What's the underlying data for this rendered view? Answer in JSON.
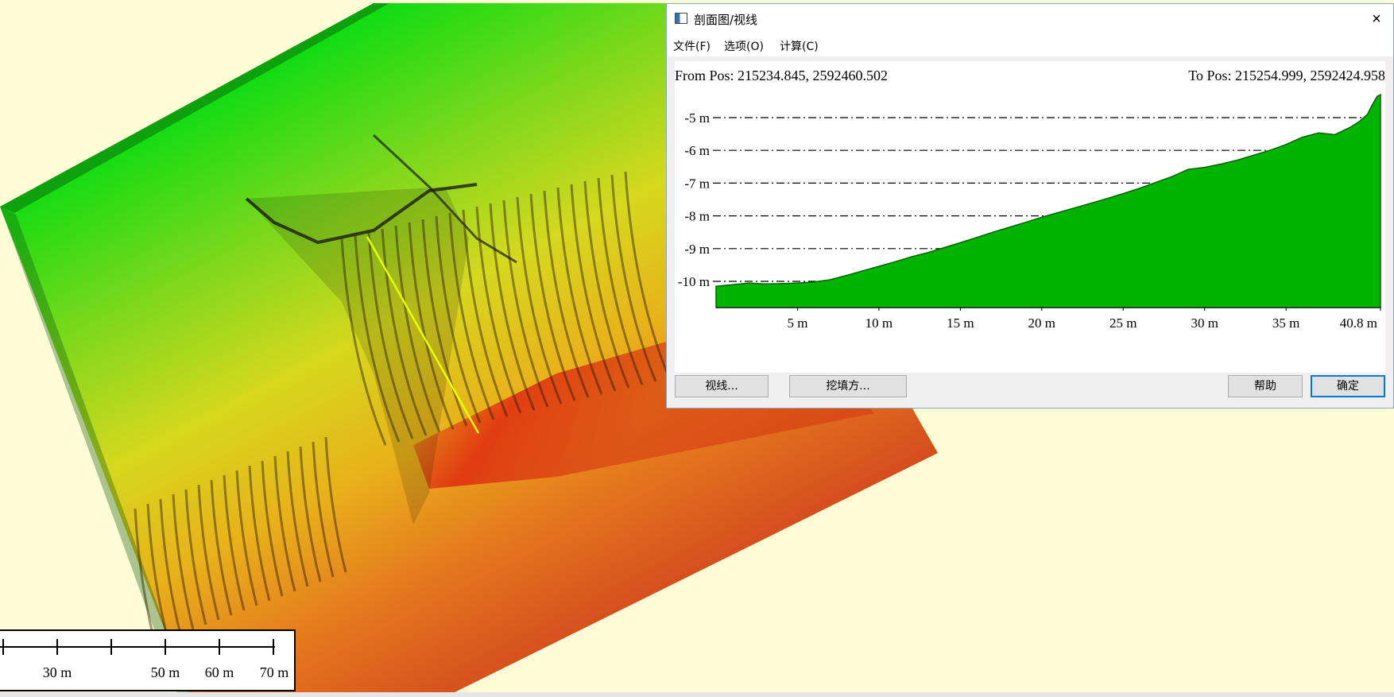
{
  "window": {
    "title": "剖面图/视线",
    "close_glyph": "×",
    "menu": [
      "文件(F)",
      "选项(O)",
      "计算(C)"
    ]
  },
  "profile": {
    "from_pos": "From Pos: 215234.845, 2592460.502",
    "to_pos": "To Pos: 215254.999, 2592424.958"
  },
  "buttons": {
    "sight_line": "视线...",
    "cut_fill": "挖填方...",
    "help": "帮助",
    "ok": "确定"
  },
  "scalebar": {
    "labels": [
      "30 m",
      "50 m",
      "60 m",
      "70 m"
    ]
  },
  "colors": {
    "profile_fill": "#00b400",
    "profile_outline": "#006400",
    "profile_line_on_map": "#e8ff00"
  },
  "chart_data": {
    "type": "area",
    "x_unit": "m",
    "y_unit": "m",
    "xlim": [
      0,
      40.8
    ],
    "ylim": [
      -10.8,
      -4.2
    ],
    "x_ticks": [
      5,
      10,
      15,
      20,
      25,
      30,
      35,
      40.8
    ],
    "x_tick_labels": [
      "5 m",
      "10 m",
      "15 m",
      "20 m",
      "25 m",
      "30 m",
      "35 m",
      "40.8 m"
    ],
    "y_ticks": [
      -5,
      -6,
      -7,
      -8,
      -9,
      -10
    ],
    "y_tick_labels": [
      "-5 m",
      "-6 m",
      "-7 m",
      "-8 m",
      "-9 m",
      "-10 m"
    ],
    "grid": "dash-dot horizontal",
    "x": [
      0,
      1,
      2,
      3,
      4,
      5,
      6,
      7,
      8,
      9,
      10,
      11,
      12,
      13,
      14,
      15,
      16,
      17,
      18,
      19,
      20,
      21,
      22,
      23,
      24,
      25,
      26,
      27,
      28,
      29,
      30,
      31,
      32,
      33,
      34,
      35,
      36,
      37,
      38,
      39,
      39.5,
      40,
      40.3,
      40.6,
      40.8
    ],
    "y": [
      -10.15,
      -10.1,
      -10.05,
      -10.08,
      -10.07,
      -10.05,
      -10.02,
      -9.95,
      -9.82,
      -9.68,
      -9.54,
      -9.4,
      -9.25,
      -9.12,
      -8.97,
      -8.82,
      -8.66,
      -8.5,
      -8.35,
      -8.2,
      -8.04,
      -7.9,
      -7.76,
      -7.62,
      -7.47,
      -7.32,
      -7.16,
      -6.98,
      -6.8,
      -6.58,
      -6.52,
      -6.42,
      -6.3,
      -6.15,
      -6.0,
      -5.82,
      -5.6,
      -5.47,
      -5.52,
      -5.28,
      -5.12,
      -4.9,
      -4.6,
      -4.35,
      -4.3
    ]
  }
}
